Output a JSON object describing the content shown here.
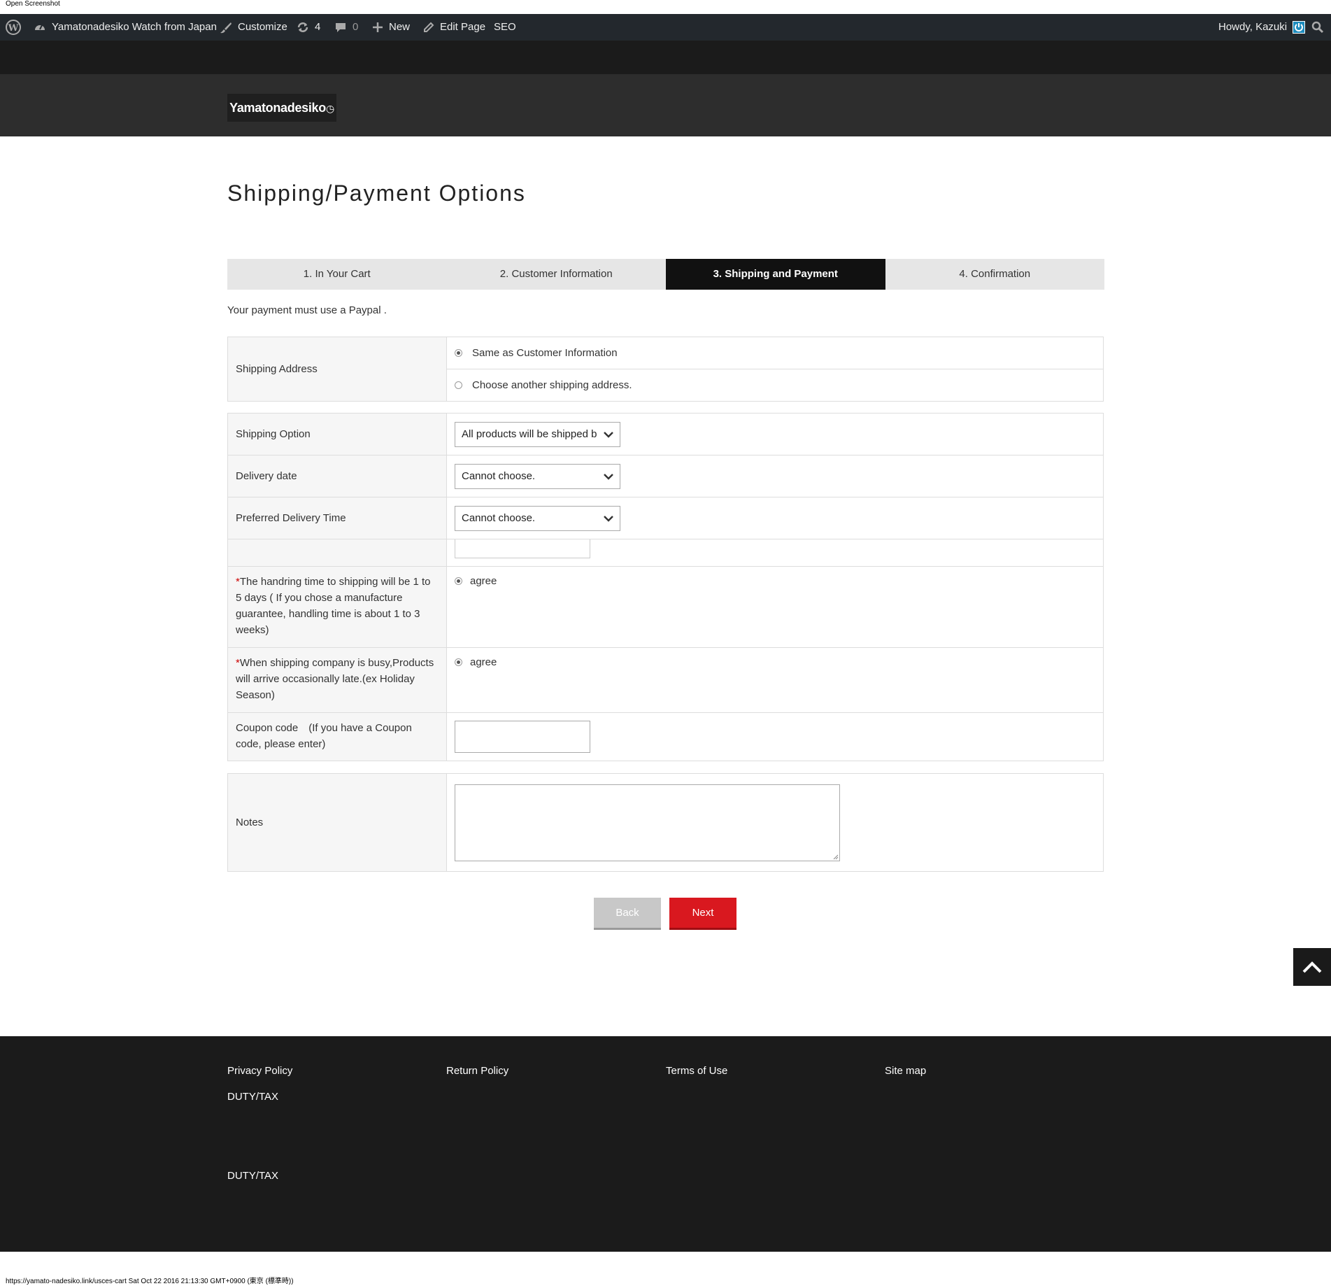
{
  "screenshot_label": "Open Screenshot",
  "admin_bar": {
    "site_name": "Yamatonadesiko Watch from Japan",
    "customize": "Customize",
    "updates_count": "4",
    "comments_count": "0",
    "new": "New",
    "edit_page": "Edit Page",
    "seo": "SEO",
    "howdy": "Howdy, Kazuki"
  },
  "logo_text": "Yamatonadesiko",
  "page_title": "Shipping/Payment Options",
  "steps": [
    {
      "label": "1. In Your Cart"
    },
    {
      "label": "2. Customer Information"
    },
    {
      "label": "3. Shipping and Payment",
      "active": true
    },
    {
      "label": "4. Confirmation"
    }
  ],
  "notice": "Your payment must use a Paypal .",
  "shipping_address": {
    "label": "Shipping Address",
    "options": [
      {
        "label": "Same as Customer Information",
        "checked": true
      },
      {
        "label": "Choose another shipping address.",
        "checked": false
      }
    ]
  },
  "shipping_option": {
    "label": "Shipping Option",
    "value": "All products will be shipped b"
  },
  "delivery_date": {
    "label": "Delivery date",
    "value": "Cannot choose."
  },
  "delivery_time": {
    "label": "Preferred Delivery Time",
    "value": "Cannot choose."
  },
  "handling_notice": {
    "required_mark": "*",
    "label": "The handring time to shipping will be 1 to 5 days ( If you chose a manufacture guarantee, handling time is about 1 to 3 weeks)",
    "agree": "agree"
  },
  "busy_notice": {
    "required_mark": "*",
    "label": "When shipping company is busy,Products will arrive occasionally late.(ex Holiday Season)",
    "agree": "agree"
  },
  "coupon": {
    "label": "Coupon code　(If you have a Coupon code, please enter)",
    "value": ""
  },
  "notes": {
    "label": "Notes",
    "value": ""
  },
  "buttons": {
    "back": "Back",
    "next": "Next"
  },
  "footer": {
    "privacy": "Privacy Policy",
    "return": "Return Policy",
    "terms": "Terms of Use",
    "sitemap": "Site map",
    "duty1": "DUTY/TAX",
    "duty2": "DUTY/TAX"
  },
  "status_url": "https://yamato-nadesiko.link/usces-cart Sat Oct 22 2016 21:13:30 GMT+0900 (東京 (標準時))"
}
